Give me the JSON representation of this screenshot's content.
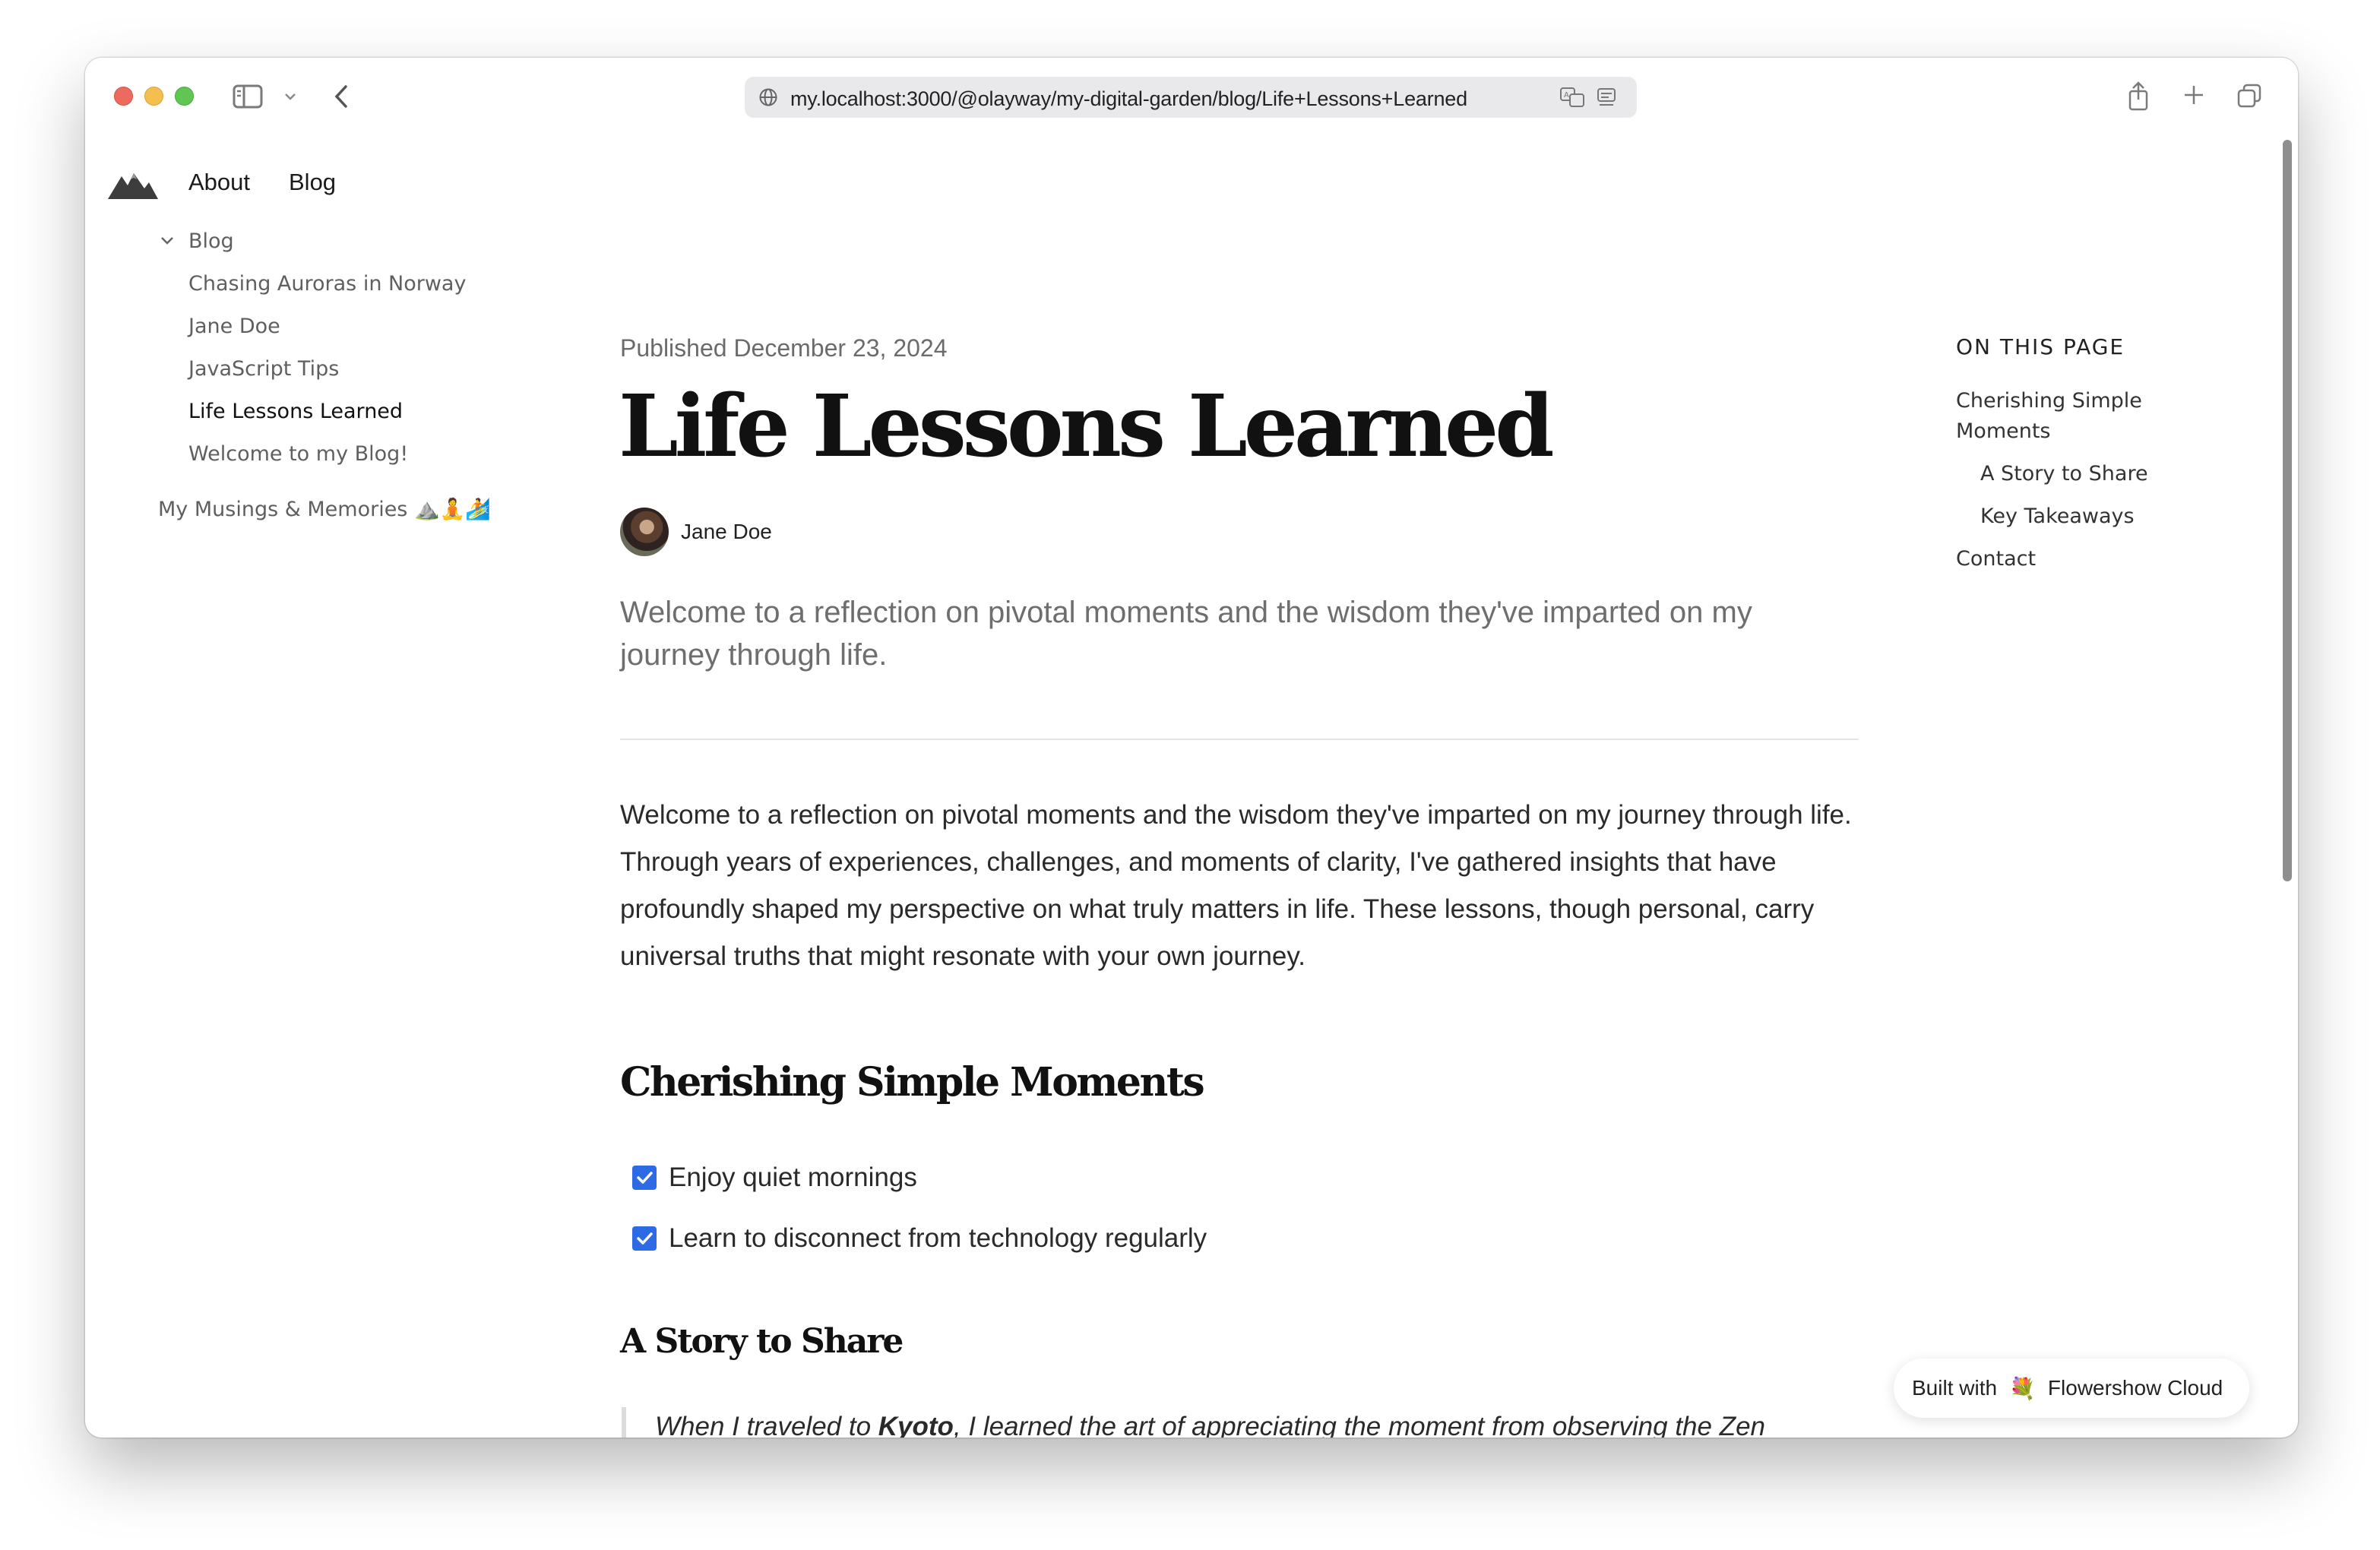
{
  "browser": {
    "url": "my.localhost:3000/@olayway/my-digital-garden/blog/Life+Lessons+Learned"
  },
  "site_nav": {
    "about": "About",
    "blog": "Blog"
  },
  "sidebar": {
    "section_label": "Blog",
    "items": [
      {
        "label": "Chasing Auroras in Norway"
      },
      {
        "label": "Jane Doe"
      },
      {
        "label": "JavaScript Tips"
      },
      {
        "label": "Life Lessons Learned"
      },
      {
        "label": "Welcome to my Blog!"
      }
    ],
    "extra": "My Musings & Memories ⛰️🧘🏄"
  },
  "article": {
    "published": "Published December 23, 2024",
    "title": "Life Lessons Learned",
    "author": "Jane Doe",
    "lead": "Welcome to a reflection on pivotal moments and the wisdom they've imparted on my journey through life.",
    "intro": "Welcome to a reflection on pivotal moments and the wisdom they've imparted on my journey through life. Through years of experiences, challenges, and moments of clarity, I've gathered insights that have profoundly shaped my perspective on what truly matters in life. These lessons, though personal, carry universal truths that might resonate with your own journey.",
    "h2": "Cherishing Simple Moments",
    "checklist": [
      {
        "label": "Enjoy quiet mornings",
        "checked": true
      },
      {
        "label": "Learn to disconnect from technology regularly",
        "checked": true
      }
    ],
    "h3": "A Story to Share",
    "quote_pre": "When I traveled to ",
    "quote_bold": "Kyoto",
    "quote_post": ", I learned the art of appreciating the moment from observing the Zen"
  },
  "toc": {
    "heading": "ON THIS PAGE",
    "items": [
      {
        "label": "Cherishing Simple Moments"
      },
      {
        "label": "A Story to Share"
      },
      {
        "label": "Key Takeaways"
      },
      {
        "label": "Contact"
      }
    ]
  },
  "footer_badge": {
    "prefix": "Built with",
    "emoji": "💐",
    "name": "Flowershow Cloud"
  },
  "colors": {
    "accent": "#2e6ae6",
    "traffic_red": "#ed6a5e",
    "traffic_yellow": "#f5bf4f",
    "traffic_green": "#61c554"
  }
}
